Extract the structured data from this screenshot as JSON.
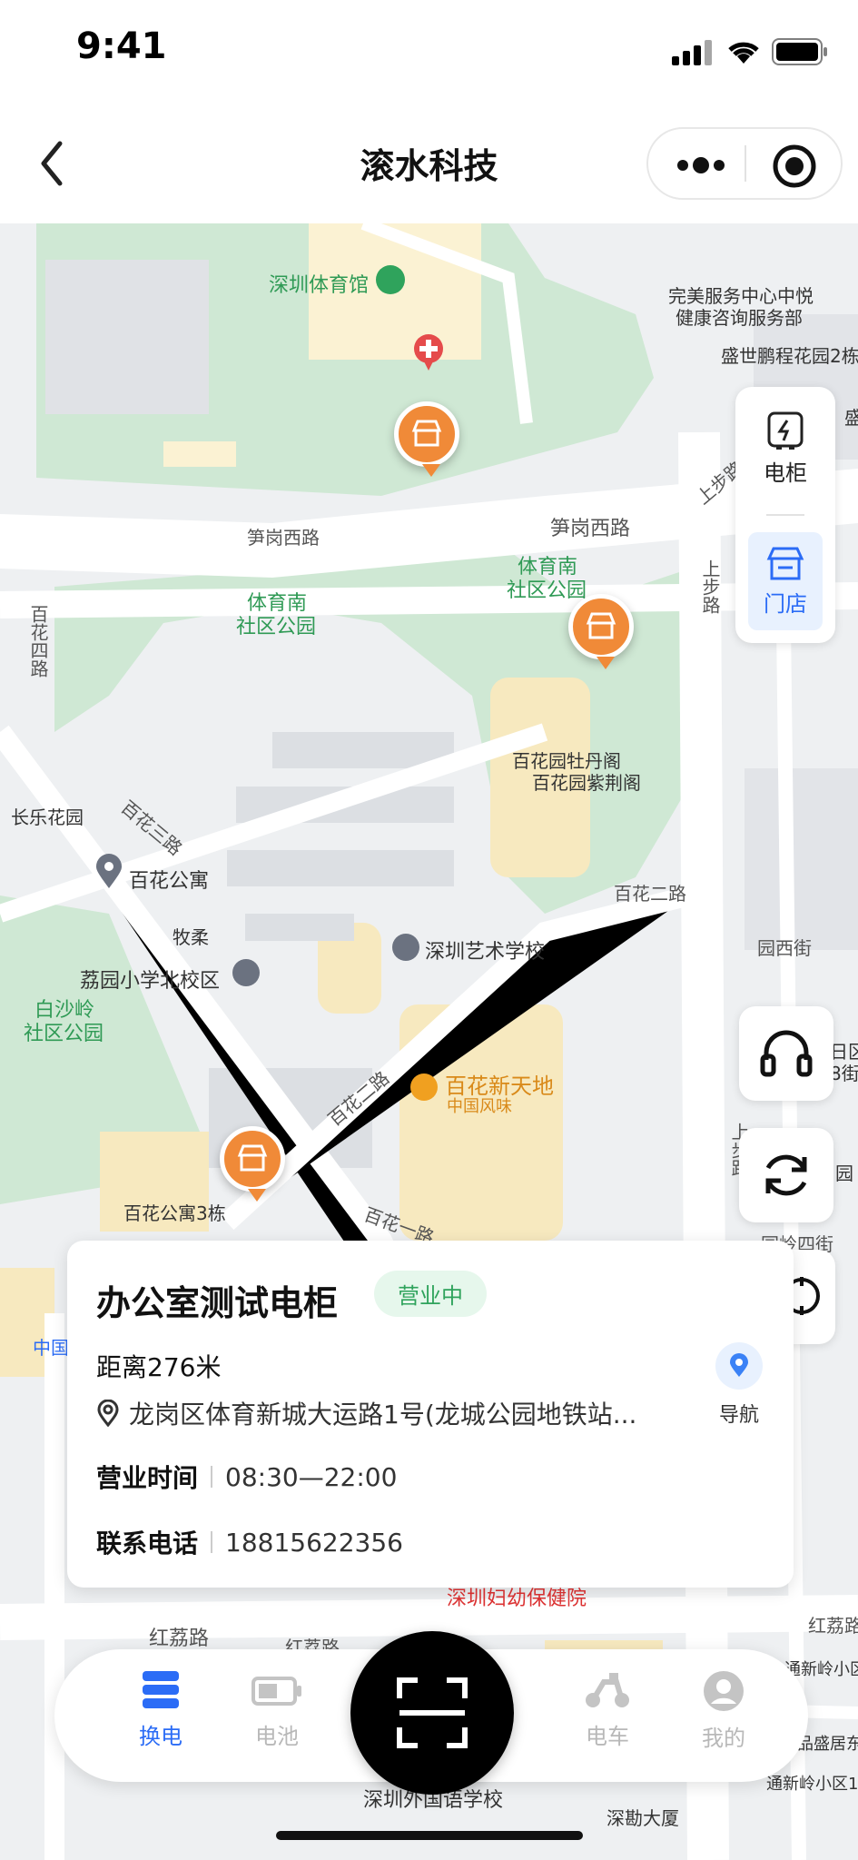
{
  "status_bar": {
    "time": "9:41"
  },
  "header": {
    "title": "滚水科技"
  },
  "map_labels": {
    "stadium": "深圳体育馆",
    "service_center_1": "完美服务中心中悦",
    "service_center_2": "健康咨询服务部",
    "shengshi": "盛世鹏程花园2栋",
    "shengshi_edge": "盛",
    "sungang_road_1": "笋岗西路",
    "sungang_road_2": "笋岗西路",
    "sports_park_1a": "体育南",
    "sports_park_1b": "社区公园",
    "sports_park_2a": "体育南",
    "sports_park_2b": "社区公园",
    "baihua_4": "百花四路",
    "shangbu_1": "上步路",
    "shangbu_2": "上步路",
    "mudan": "百花园牡丹阁",
    "zijing": "百花园紫荆阁",
    "changle": "长乐花园",
    "baihua_3": "百花三路",
    "baihua_apt": "百花公寓",
    "baihua_2a": "百花二路",
    "muru": "牧柔",
    "art_school": "深圳艺术学校",
    "liyuan_school": "荔园小学北校区",
    "baishaling_a": "白沙岭",
    "baishaling_b": "社区公园",
    "yuanxi": "园西街",
    "baihua_xintiandi": "百花新天地",
    "chinese_food": "中国风味",
    "baihua_2b": "百花二路",
    "baihua_apt3": "百花公寓3栋",
    "baihua_1": "百花一路",
    "maternal": "深圳妇幼保健院",
    "hongli": "红荔路",
    "hongli_2": "红荔路",
    "hongli_right": "红荔路",
    "foreign_school": "深圳外国语学校",
    "shenkan": "深勘大厦",
    "yuan_edge": "园",
    "jie_edge": "日区",
    "jie_edge2": "8街",
    "xinling": "通新岭小区",
    "pinsheng": "品盛居东",
    "xinling2": "通新岭小区1",
    "zhong": "中国",
    "shangbu_3": "上步路",
    "yuanling": "园岭四街"
  },
  "side_panel": {
    "cabinet_label": "电柜",
    "store_label": "门店"
  },
  "store_card": {
    "name": "办公室测试电柜",
    "status": "营业中",
    "distance": "距离276米",
    "address": "龙岗区体育新城大运路1号(龙城公园地铁站...",
    "nav_label": "导航",
    "hours_label": "营业时间",
    "hours_value": "08:30—22:00",
    "phone_label": "联系电话",
    "phone_value": "18815622356"
  },
  "tabbar": {
    "swap": "换电",
    "battery": "电池",
    "ebike": "电车",
    "mine": "我的"
  },
  "colors": {
    "accent_blue": "#2b6cf6",
    "pin_orange": "#f08a38",
    "open_green": "#2fa35c",
    "park_green": "#cfe8d4"
  },
  "icons": [
    "back-icon",
    "more-icon",
    "target-icon",
    "cabinet-icon",
    "store-icon",
    "headset-icon",
    "refresh-icon",
    "location-pin-icon",
    "navigation-icon",
    "swap-icon",
    "battery-icon",
    "scan-icon",
    "ebike-icon",
    "user-icon"
  ]
}
